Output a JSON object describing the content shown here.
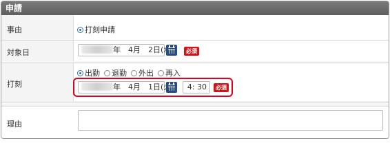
{
  "panel_title": "申請",
  "rows": {
    "reason_type": {
      "label": "事由",
      "option": "打刻申請"
    },
    "target_date": {
      "label": "対象日",
      "date_text": "年　4月　2日(水)",
      "required_badge": "必須"
    },
    "punch": {
      "label": "打刻",
      "options": [
        "出勤",
        "退勤",
        "外出",
        "再入"
      ],
      "selected": "出勤",
      "date_text": "年　4月　1日(火)",
      "time_value": "4: 30",
      "required_badge": "必須"
    },
    "reason": {
      "label": "理由",
      "value": ""
    }
  },
  "icons": {
    "calendar": "calendar-icon",
    "radio": "radio-icon"
  },
  "colors": {
    "header_bg": "#6b6b6b",
    "badge_red": "#d0141a",
    "highlight_red": "#e0001b",
    "calendar_blue": "#244c8a",
    "radio_blue": "#2f6fb0"
  }
}
